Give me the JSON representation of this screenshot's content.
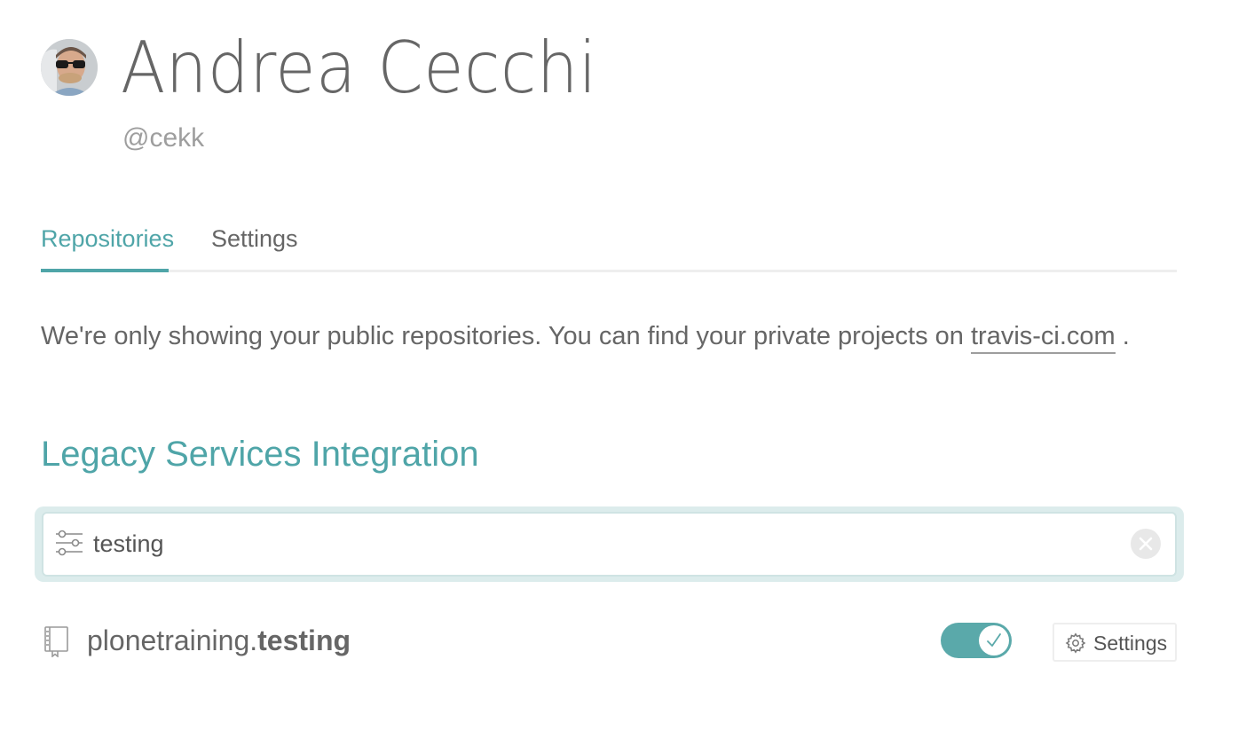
{
  "profile": {
    "name": "Andrea Cecchi",
    "handle": "@cekk",
    "avatar": "avatar-photo"
  },
  "tabs": [
    {
      "label": "Repositories",
      "active": true
    },
    {
      "label": "Settings",
      "active": false
    }
  ],
  "notice": {
    "text": "We're only showing your public repositories. You can find your private projects on",
    "link_text": "travis-ci.com",
    "suffix": "."
  },
  "section": {
    "title": "Legacy Services Integration"
  },
  "search": {
    "value": "testing",
    "placeholder": "",
    "icon": "filter-sliders-icon",
    "clear_icon": "close-circle-icon"
  },
  "repositories": [
    {
      "owner": "plonetraining.",
      "name": "testing",
      "icon": "repo-book-icon",
      "enabled": true,
      "settings_label": "Settings",
      "settings_icon": "gear-icon"
    }
  ],
  "colors": {
    "accent": "#4fa5a8",
    "toggle_on": "#5aa9aa",
    "text": "#666666",
    "muted": "#9e9e9e"
  }
}
